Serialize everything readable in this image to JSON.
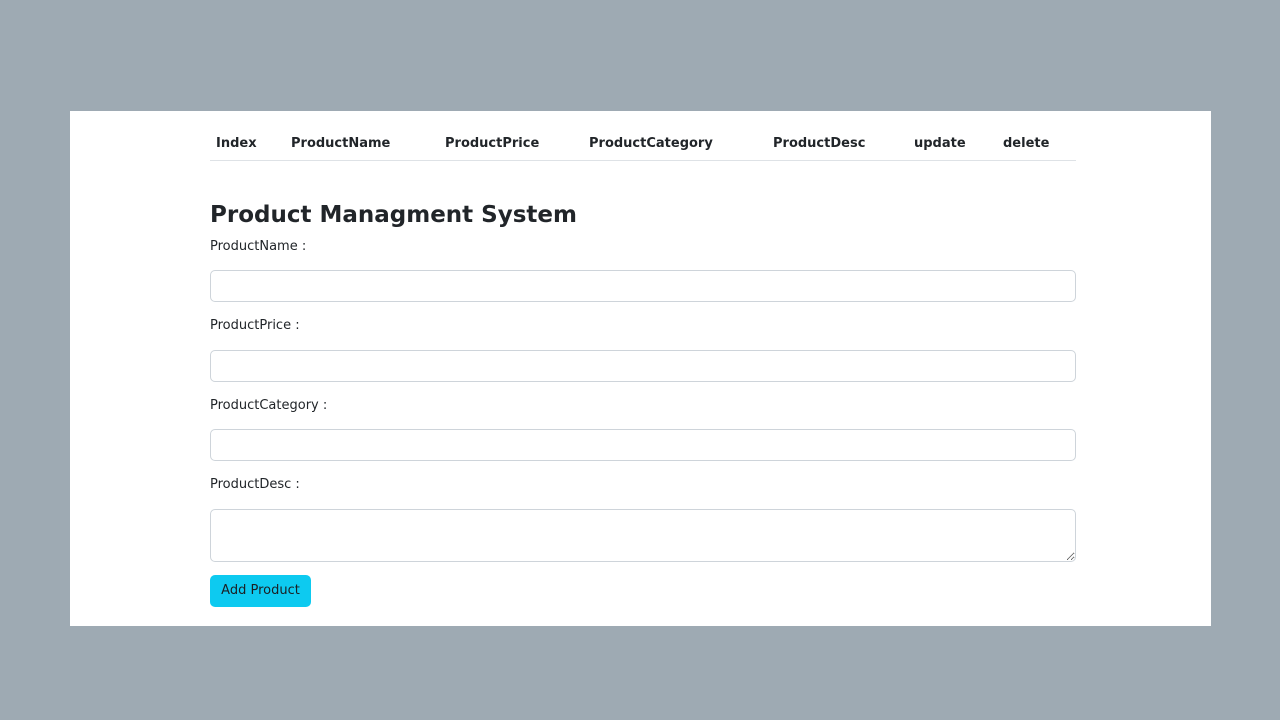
{
  "table": {
    "headers": [
      "Index",
      "ProductName",
      "ProductPrice",
      "ProductCategory",
      "ProductDesc",
      "update",
      "delete"
    ]
  },
  "form": {
    "title": "Product Managment System",
    "name_label": "ProductName :",
    "price_label": "ProductPrice :",
    "category_label": "ProductCategory :",
    "desc_label": "ProductDesc :",
    "name_value": "",
    "price_value": "",
    "category_value": "",
    "desc_value": "",
    "submit_label": "Add Product"
  },
  "colors": {
    "page_background": "#9eaab3",
    "card_background": "#ffffff",
    "button_accent": "#0dcaf0"
  }
}
